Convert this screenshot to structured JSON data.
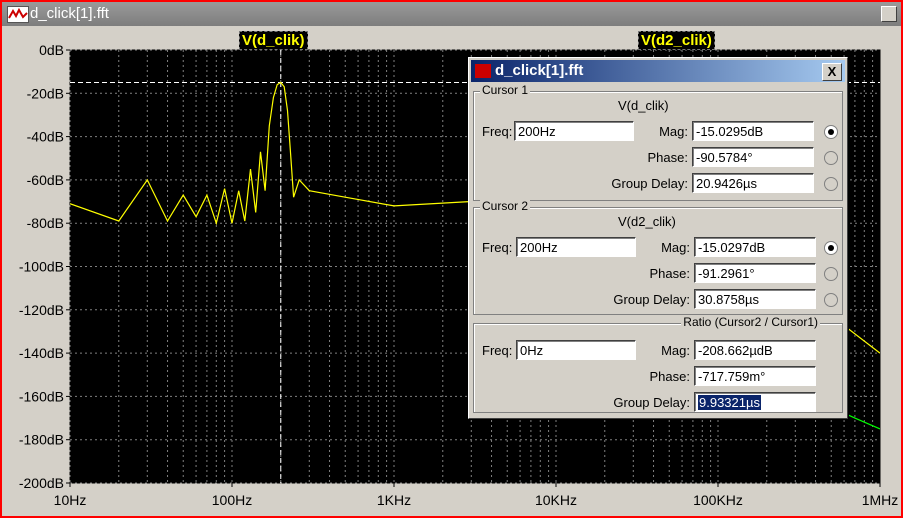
{
  "window": {
    "title": "d_click[1].fft"
  },
  "plot": {
    "y_ticks": [
      "0dB",
      "-20dB",
      "-40dB",
      "-60dB",
      "-80dB",
      "-100dB",
      "-120dB",
      "-140dB",
      "-160dB",
      "-180dB",
      "-200dB"
    ],
    "x_ticks": [
      "10Hz",
      "100Hz",
      "1KHz",
      "10KHz",
      "100KHz",
      "1MHz"
    ],
    "trace1_label": "V(d_clik)",
    "trace2_label": "V(d2_clik)",
    "colors": {
      "background": "#000000",
      "trace1": "#ffff00",
      "trace2": "#00ff00",
      "grid": "#808080"
    }
  },
  "chart_data": {
    "type": "line",
    "xscale": "log",
    "xlim": [
      10,
      1000000
    ],
    "ylim": [
      -200,
      0
    ],
    "x_ticks": [
      "10Hz",
      "100Hz",
      "1KHz",
      "10KHz",
      "100KHz",
      "1MHz"
    ],
    "y_ticks": [
      "0dB",
      "-20dB",
      "-40dB",
      "-60dB",
      "-80dB",
      "-100dB",
      "-120dB",
      "-140dB",
      "-160dB",
      "-180dB",
      "-200dB"
    ],
    "grid": true,
    "series": [
      {
        "name": "V(d_clik)",
        "color": "#ffff00",
        "x": [
          10,
          20,
          30,
          40,
          50,
          60,
          70,
          80,
          90,
          100,
          110,
          120,
          130,
          140,
          150,
          160,
          170,
          180,
          190,
          200,
          210,
          220,
          230,
          240,
          260,
          300,
          500,
          1000,
          3000,
          10000,
          100000,
          300000,
          1000000
        ],
        "y": [
          -71,
          -79,
          -60,
          -79,
          -67,
          -77,
          -67,
          -80,
          -64,
          -80,
          -65,
          -79,
          -55,
          -75,
          -47,
          -65,
          -35,
          -22,
          -16,
          -15,
          -17,
          -28,
          -48,
          -68,
          -60,
          -65,
          -68,
          -72,
          -70,
          -75,
          -75,
          -110,
          -140
        ]
      },
      {
        "name": "V(d2_clik)",
        "color": "#00ff00",
        "x": [
          300000,
          500000,
          700000,
          1000000
        ],
        "y": [
          -155,
          -165,
          -170,
          -175
        ]
      }
    ]
  },
  "dialog": {
    "title": "d_click[1].fft",
    "close_label": "X",
    "cursor1": {
      "legend": "Cursor 1",
      "trace": "V(d_clik)",
      "freq_label": "Freq:",
      "freq": "200Hz",
      "mag_label": "Mag:",
      "mag": "-15.0295dB",
      "phase_label": "Phase:",
      "phase": "-90.5784°",
      "gd_label": "Group Delay:",
      "gd": "20.9426µs"
    },
    "cursor2": {
      "legend": "Cursor 2",
      "trace": "V(d2_clik)",
      "freq_label": "Freq:",
      "freq": "200Hz",
      "mag_label": "Mag:",
      "mag": "-15.0297dB",
      "phase_label": "Phase:",
      "phase": "-91.2961°",
      "gd_label": "Group Delay:",
      "gd": "30.8758µs"
    },
    "ratio": {
      "legend": "Ratio (Cursor2 / Cursor1)",
      "freq_label": "Freq:",
      "freq": "0Hz",
      "mag_label": "Mag:",
      "mag": "-208.662µdB",
      "phase_label": "Phase:",
      "phase": "-717.759m°",
      "gd_label": "Group Delay:",
      "gd": "9.93321µs"
    }
  }
}
